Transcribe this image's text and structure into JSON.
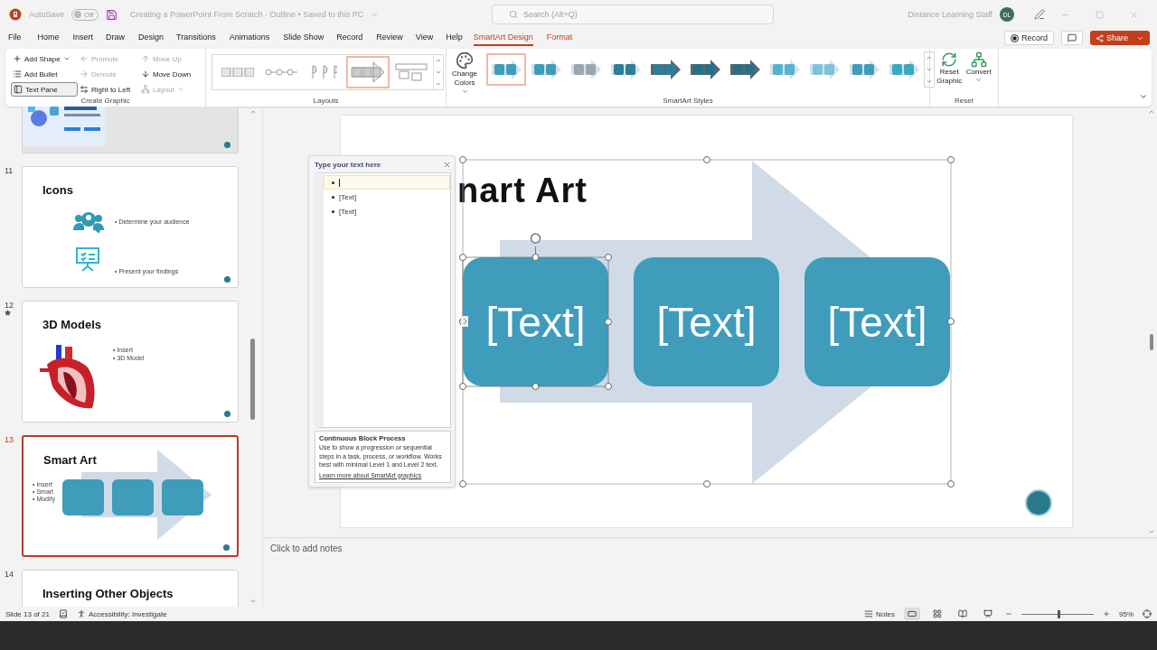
{
  "title_bar": {
    "autosave_label": "AutoSave",
    "autosave": {
      "label": "Off",
      "on": false
    },
    "document_title": "Creating a PowerPoint From Scratch · Outline • Saved to this PC",
    "search": {
      "placeholder": "Search (Alt+Q)"
    },
    "user_name": "Distance Learning Staff",
    "avatar": "DL"
  },
  "menu_tabs": [
    {
      "label": "File",
      "selected": false,
      "kind": "plain"
    },
    {
      "label": "Home",
      "selected": false,
      "kind": "plain"
    },
    {
      "label": "Insert",
      "selected": false,
      "kind": "plain"
    },
    {
      "label": "Draw",
      "selected": false,
      "kind": "plain"
    },
    {
      "label": "Design",
      "selected": false,
      "kind": "plain"
    },
    {
      "label": "Transitions",
      "selected": false,
      "kind": "plain"
    },
    {
      "label": "Animations",
      "selected": false,
      "kind": "plain"
    },
    {
      "label": "Slide Show",
      "selected": false,
      "kind": "plain"
    },
    {
      "label": "Record",
      "selected": false,
      "kind": "plain"
    },
    {
      "label": "Review",
      "selected": false,
      "kind": "plain"
    },
    {
      "label": "View",
      "selected": false,
      "kind": "plain"
    },
    {
      "label": "Help",
      "selected": false,
      "kind": "plain"
    },
    {
      "label": "SmartArt Design",
      "selected": true,
      "kind": "contextual"
    },
    {
      "label": "Format",
      "selected": false,
      "kind": "contextual"
    }
  ],
  "actions": [
    {
      "label": "Record",
      "kind": "record"
    },
    {
      "kind": "comments"
    },
    {
      "label": "Share",
      "kind": "share"
    }
  ],
  "ribbon": {
    "create_graphic": {
      "label": "Create Graphic",
      "commands": [
        {
          "label": "Add Shape",
          "disabled": false,
          "on": false,
          "dropdown": true
        },
        {
          "label": "Promote",
          "disabled": true,
          "on": false,
          "dropdown": false
        },
        {
          "label": "Move Up",
          "disabled": true,
          "on": false,
          "dropdown": false
        },
        {
          "label": "Add Bullet",
          "disabled": false,
          "on": false,
          "dropdown": false
        },
        {
          "label": "Demote",
          "disabled": true,
          "on": false,
          "dropdown": false
        },
        {
          "label": "Move Down",
          "disabled": false,
          "on": false,
          "dropdown": false
        },
        {
          "label": "Text Pane",
          "disabled": false,
          "on": true,
          "dropdown": false
        },
        {
          "label": "Right to Left",
          "disabled": false,
          "on": false,
          "dropdown": false
        },
        {
          "label": "Layout",
          "disabled": true,
          "on": false,
          "dropdown": true
        }
      ]
    },
    "layouts": {
      "label": "Layouts",
      "items": [
        {
          "selected": false
        },
        {
          "selected": false
        },
        {
          "selected": false
        },
        {
          "selected": true
        },
        {
          "selected": false
        }
      ]
    },
    "change_colors": {
      "label": "Change Colors"
    },
    "styles": {
      "label": "SmartArt Styles",
      "items": [
        {
          "selected": true
        },
        {
          "selected": false
        },
        {
          "selected": false
        },
        {
          "selected": false
        },
        {
          "selected": false
        },
        {
          "selected": false
        },
        {
          "selected": false
        },
        {
          "selected": false
        },
        {
          "selected": false
        },
        {
          "selected": false
        },
        {
          "selected": false
        }
      ]
    },
    "reset": {
      "label": "Reset",
      "commands": [
        {
          "label": "Reset Graphic",
          "dropdown": false
        },
        {
          "label": "Convert",
          "dropdown": true
        }
      ]
    }
  },
  "slides": [
    {
      "kind": "picture",
      "selected": false,
      "animated": false
    },
    {
      "number": "11",
      "kind": "icons",
      "title": "Icons",
      "bullets": [
        "• Determine your audience",
        "• Present your findings"
      ],
      "selected": false,
      "animated": false
    },
    {
      "number": "12",
      "kind": "model",
      "title": "3D Models",
      "bullets": [
        "• Insert",
        "• 3D Model"
      ],
      "selected": false,
      "animated": true
    },
    {
      "number": "13",
      "kind": "smartart",
      "title": "Smart Art",
      "bullets": [
        "• Insert",
        "• Smart",
        "• Modify"
      ],
      "selected": true,
      "animated": false
    },
    {
      "number": "14",
      "kind": "title",
      "title": "Inserting Other Objects",
      "selected": false,
      "animated": false
    }
  ],
  "text_pane": {
    "title": "Type your text here",
    "items": [
      {
        "active": true
      },
      {
        "text": "[Text]",
        "active": false
      },
      {
        "text": "[Text]",
        "active": false
      }
    ],
    "description": {
      "title": "Continuous Block Process",
      "body": "Use to show a progression or sequential steps in a task, process, or workflow. Works best with minimal Level 1 and Level 2 text.",
      "link": "Learn more about SmartArt graphics"
    }
  },
  "slide": {
    "title": "nart Art",
    "shapes": [
      {
        "text": "[Text]",
        "selected": true
      },
      {
        "text": "[Text]",
        "selected": false
      },
      {
        "text": "[Text]",
        "selected": false
      }
    ]
  },
  "notes": {
    "text": "Click to add notes"
  },
  "status_bar": {
    "slide_position": "Slide 13 of 21",
    "accessibility": "Accessibility: Investigate",
    "notes": "Notes",
    "views": [
      {
        "kind": "normal",
        "selected": true
      },
      {
        "kind": "sorter",
        "selected": false
      },
      {
        "kind": "reading",
        "selected": false
      },
      {
        "kind": "slideshow",
        "selected": false
      }
    ],
    "zoom": {
      "level": 0.5,
      "reading": "95%"
    }
  }
}
